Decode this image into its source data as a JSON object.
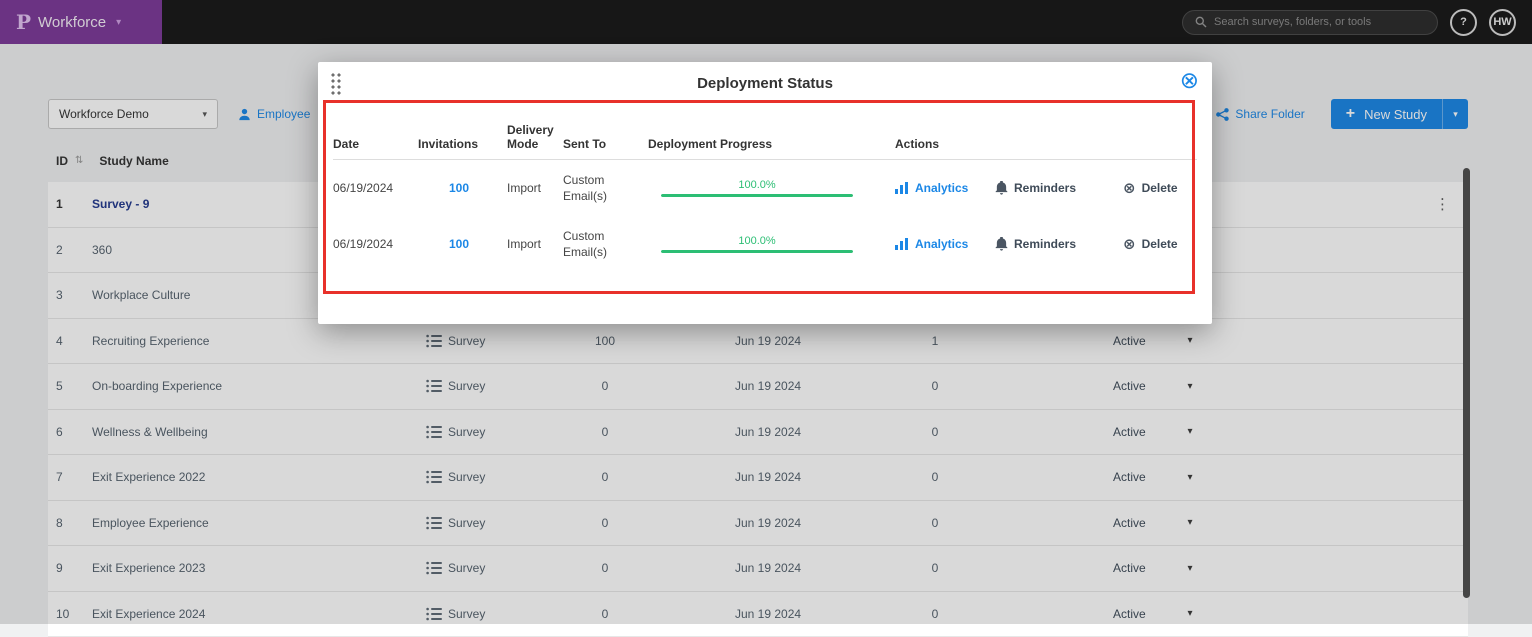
{
  "colors": {
    "accent_blue": "#1B87E6",
    "progress_green": "#2CBE74",
    "annotation_red": "#E8312A",
    "brand_purple": "#7D3A99",
    "topbar_black": "#181818",
    "highlight_name_blue": "#233A8F"
  },
  "icons": {
    "caret": "▾",
    "sort": "⇅",
    "kebab": "⋮",
    "close_circle": "⊗",
    "delete_circle": "⊗",
    "plus": "+"
  },
  "topbar": {
    "logo_letter": "P",
    "brand": "Workforce",
    "search_placeholder": "Search surveys, folders, or tools",
    "help_label": "?",
    "avatar_initials": "HW"
  },
  "toolbar": {
    "folder_select_value": "Workforce Demo",
    "employee_link": "Employee",
    "share_folder_label": "Share Folder",
    "new_study_label": "New Study"
  },
  "study_table": {
    "headers": {
      "id": "ID",
      "study_name": "Study Name"
    },
    "rows": [
      {
        "id": "1",
        "name": "Survey - 9",
        "type": "",
        "responses": "",
        "date": "",
        "count": "",
        "status": "",
        "highlight": true,
        "menu": true
      },
      {
        "id": "2",
        "name": "360",
        "type": "",
        "responses": "",
        "date": "",
        "count": "",
        "status": "",
        "highlight": false,
        "menu": false
      },
      {
        "id": "3",
        "name": "Workplace Culture",
        "type": "",
        "responses": "",
        "date": "",
        "count": "",
        "status": "",
        "highlight": false,
        "menu": false
      },
      {
        "id": "4",
        "name": "Recruiting Experience",
        "type": "Survey",
        "responses": "100",
        "date": "Jun 19 2024",
        "count": "1",
        "status": "Active",
        "highlight": false,
        "menu": false
      },
      {
        "id": "5",
        "name": "On-boarding Experience",
        "type": "Survey",
        "responses": "0",
        "date": "Jun 19 2024",
        "count": "0",
        "status": "Active",
        "highlight": false,
        "menu": false
      },
      {
        "id": "6",
        "name": "Wellness & Wellbeing",
        "type": "Survey",
        "responses": "0",
        "date": "Jun 19 2024",
        "count": "0",
        "status": "Active",
        "highlight": false,
        "menu": false
      },
      {
        "id": "7",
        "name": "Exit Experience 2022",
        "type": "Survey",
        "responses": "0",
        "date": "Jun 19 2024",
        "count": "0",
        "status": "Active",
        "highlight": false,
        "menu": false
      },
      {
        "id": "8",
        "name": "Employee Experience",
        "type": "Survey",
        "responses": "0",
        "date": "Jun 19 2024",
        "count": "0",
        "status": "Active",
        "highlight": false,
        "menu": false
      },
      {
        "id": "9",
        "name": "Exit Experience 2023",
        "type": "Survey",
        "responses": "0",
        "date": "Jun 19 2024",
        "count": "0",
        "status": "Active",
        "highlight": false,
        "menu": false
      },
      {
        "id": "10",
        "name": "Exit Experience 2024",
        "type": "Survey",
        "responses": "0",
        "date": "Jun 19 2024",
        "count": "0",
        "status": "Active",
        "highlight": false,
        "menu": false
      }
    ]
  },
  "modal": {
    "title": "Deployment Status",
    "columns": {
      "date": "Date",
      "invitations": "Invitations",
      "delivery_mode": "Delivery Mode",
      "sent_to": "Sent To",
      "progress": "Deployment Progress",
      "actions": "Actions"
    },
    "rows": [
      {
        "date": "06/19/2024",
        "invitations": "100",
        "mode": "Import",
        "sent_to": "Custom Email(s)",
        "progress_label": "100.0%",
        "progress_value": 100
      },
      {
        "date": "06/19/2024",
        "invitations": "100",
        "mode": "Import",
        "sent_to": "Custom Email(s)",
        "progress_label": "100.0%",
        "progress_value": 100
      }
    ],
    "action_labels": {
      "analytics": "Analytics",
      "reminders": "Reminders",
      "delete": "Delete"
    }
  }
}
